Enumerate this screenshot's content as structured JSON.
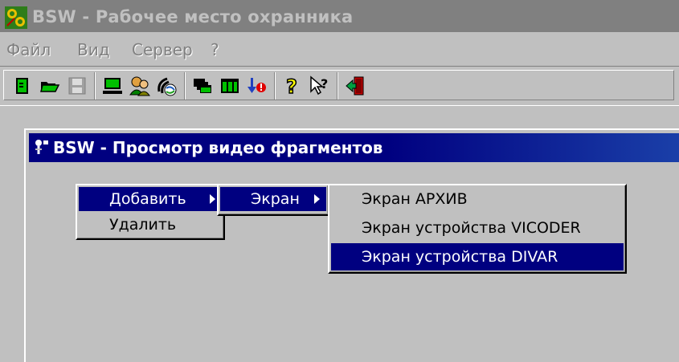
{
  "window": {
    "title": "BSW - Рабочее место охранника"
  },
  "menubar": {
    "items": [
      "Файл",
      "Вид",
      "Сервер",
      "?"
    ]
  },
  "toolbar": {
    "icons": [
      "new-icon",
      "open-icon",
      "save-icon",
      "computer-icon",
      "users-icon",
      "satellite-icon",
      "cascade-windows-icon",
      "tile-windows-icon",
      "alarm-icon",
      "help-icon",
      "context-help-icon",
      "exit-icon"
    ]
  },
  "child_window": {
    "title": "BSW - Просмотр видео фрагментов"
  },
  "context_menu": {
    "level1": [
      {
        "label": "Добавить",
        "selected": true,
        "submenu": true
      },
      {
        "label": "Удалить",
        "selected": false,
        "submenu": false
      }
    ],
    "level2": [
      {
        "label": "Экран",
        "selected": true,
        "submenu": true
      }
    ],
    "level3": [
      {
        "label": "Экран АРХИВ",
        "selected": false
      },
      {
        "label": "Экран устройства VICODER",
        "selected": false
      },
      {
        "label": "Экран устройства DIVAR",
        "selected": true
      }
    ]
  },
  "colors": {
    "face": "#c0c0c0",
    "highlight": "#000080",
    "title_inactive": "#808080"
  }
}
